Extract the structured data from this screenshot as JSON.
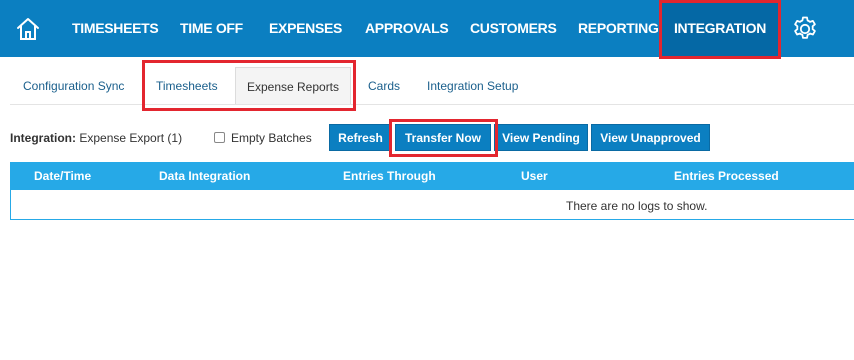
{
  "nav": {
    "items": [
      {
        "label": "TIMESHEETS"
      },
      {
        "label": "TIME OFF"
      },
      {
        "label": "EXPENSES"
      },
      {
        "label": "APPROVALS"
      },
      {
        "label": "CUSTOMERS"
      },
      {
        "label": "REPORTING"
      },
      {
        "label": "INTEGRATION",
        "active": true
      }
    ],
    "home_icon": "home-icon",
    "settings_icon": "gear-icon"
  },
  "subtabs": [
    {
      "label": "Configuration Sync"
    },
    {
      "label": "Timesheets"
    },
    {
      "label": "Expense Reports",
      "selected": true
    },
    {
      "label": "Cards"
    },
    {
      "label": "Integration Setup"
    }
  ],
  "controls": {
    "integration_label": "Integration:",
    "integration_value": "Expense Export (1)",
    "empty_batches_label": "Empty Batches",
    "empty_batches_checked": false,
    "buttons": {
      "refresh": "Refresh",
      "transfer_now": "Transfer Now",
      "view_pending": "View Pending",
      "view_unapproved": "View Unapproved"
    }
  },
  "table": {
    "columns": [
      "Date/Time",
      "Data Integration",
      "Entries Through",
      "User",
      "Entries Processed"
    ],
    "empty_message": "There are no logs to show."
  },
  "colors": {
    "nav_bg": "#0b7fc1",
    "nav_active_bg": "#0568a5",
    "table_header": "#26a9e7",
    "highlight": "#e3262f"
  }
}
